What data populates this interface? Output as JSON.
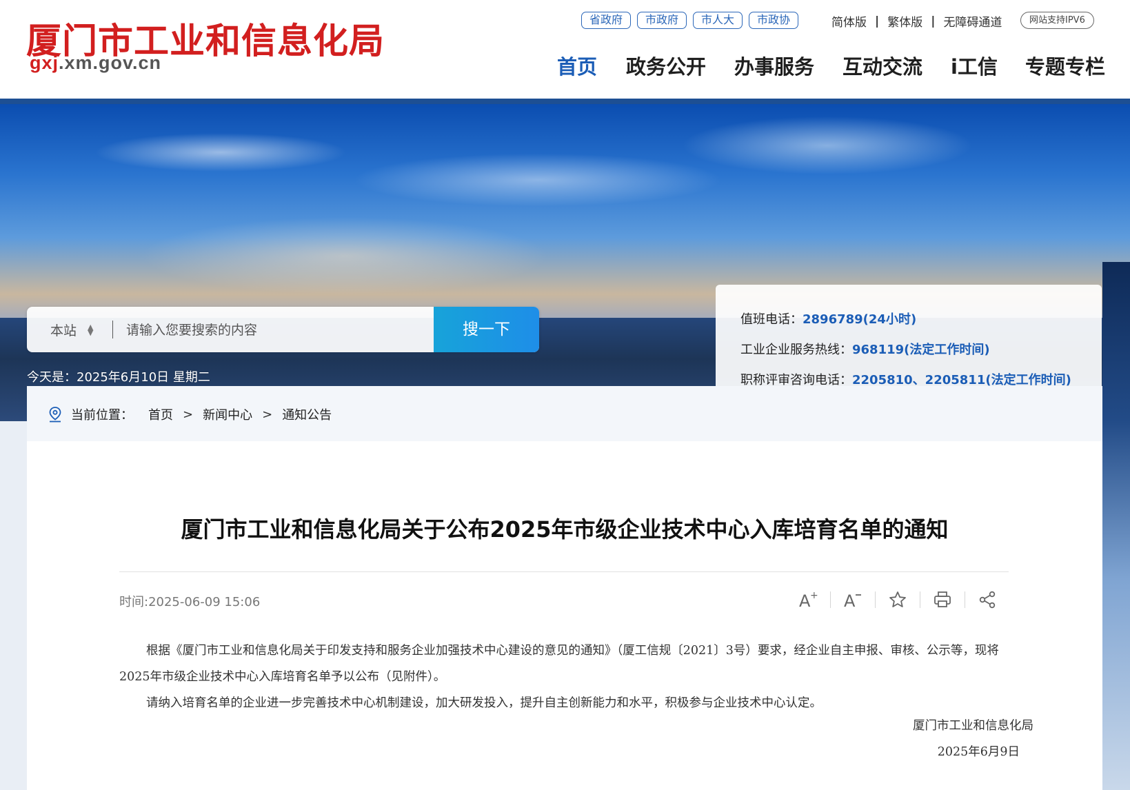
{
  "header": {
    "logo_cn": "厦门市工业和信息化局",
    "logo_domain_prefix": "gxj",
    "logo_domain_suffix": ".xm.gov.cn",
    "top_links": [
      "省政府",
      "市政府",
      "市人大",
      "市政协"
    ],
    "versions": [
      "简体版",
      "繁体版",
      "无障碍通道"
    ],
    "version_sep": "|",
    "ipv6": "网站支持IPV6",
    "nav": [
      "首页",
      "政务公开",
      "办事服务",
      "互动交流",
      "i工信",
      "专题专栏"
    ],
    "nav_active_index": 0
  },
  "search": {
    "scope": "本站",
    "placeholder": "请输入您要搜索的内容",
    "button": "搜一下"
  },
  "date": "今天是：2025年6月10日 星期二",
  "hotlines": [
    {
      "label": "值班电话：",
      "value": "2896789(24小时)"
    },
    {
      "label": "工业企业服务热线：",
      "value": "968119(法定工作时间)"
    },
    {
      "label": "职称评审咨询电话：",
      "value": "2205810、2205811(法定工作时间)"
    }
  ],
  "breadcrumb": {
    "label": "当前位置：",
    "items": [
      "首页",
      "新闻中心",
      "通知公告"
    ],
    "separator": ">"
  },
  "article": {
    "title": "厦门市工业和信息化局关于公布2025年市级企业技术中心入库培育名单的通知",
    "time": "时间:2025-06-09 15:06",
    "tools": [
      "font-increase-icon",
      "font-decrease-icon",
      "star-icon",
      "print-icon",
      "share-icon"
    ],
    "paragraphs": [
      "根据《厦门市工业和信息化局关于印发支持和服务企业加强技术中心建设的意见的通知》（厦工信规〔2021〕3号）要求，经企业自主申报、审核、公示等，现将2025年市级企业技术中心入库培育名单予以公布（见附件）。",
      "请纳入培育名单的企业进一步完善技术中心机制建设，加大研发投入，提升自主创新能力和水平，积极参与企业技术中心认定。"
    ],
    "signature": "厦门市工业和信息化局",
    "sign_date": "2025年6月9日"
  },
  "colors": {
    "brand_red": "#d21f1f",
    "brand_blue": "#1b5db6",
    "header_bar": "#1d4f93",
    "search_button": "#1e8ee8"
  }
}
